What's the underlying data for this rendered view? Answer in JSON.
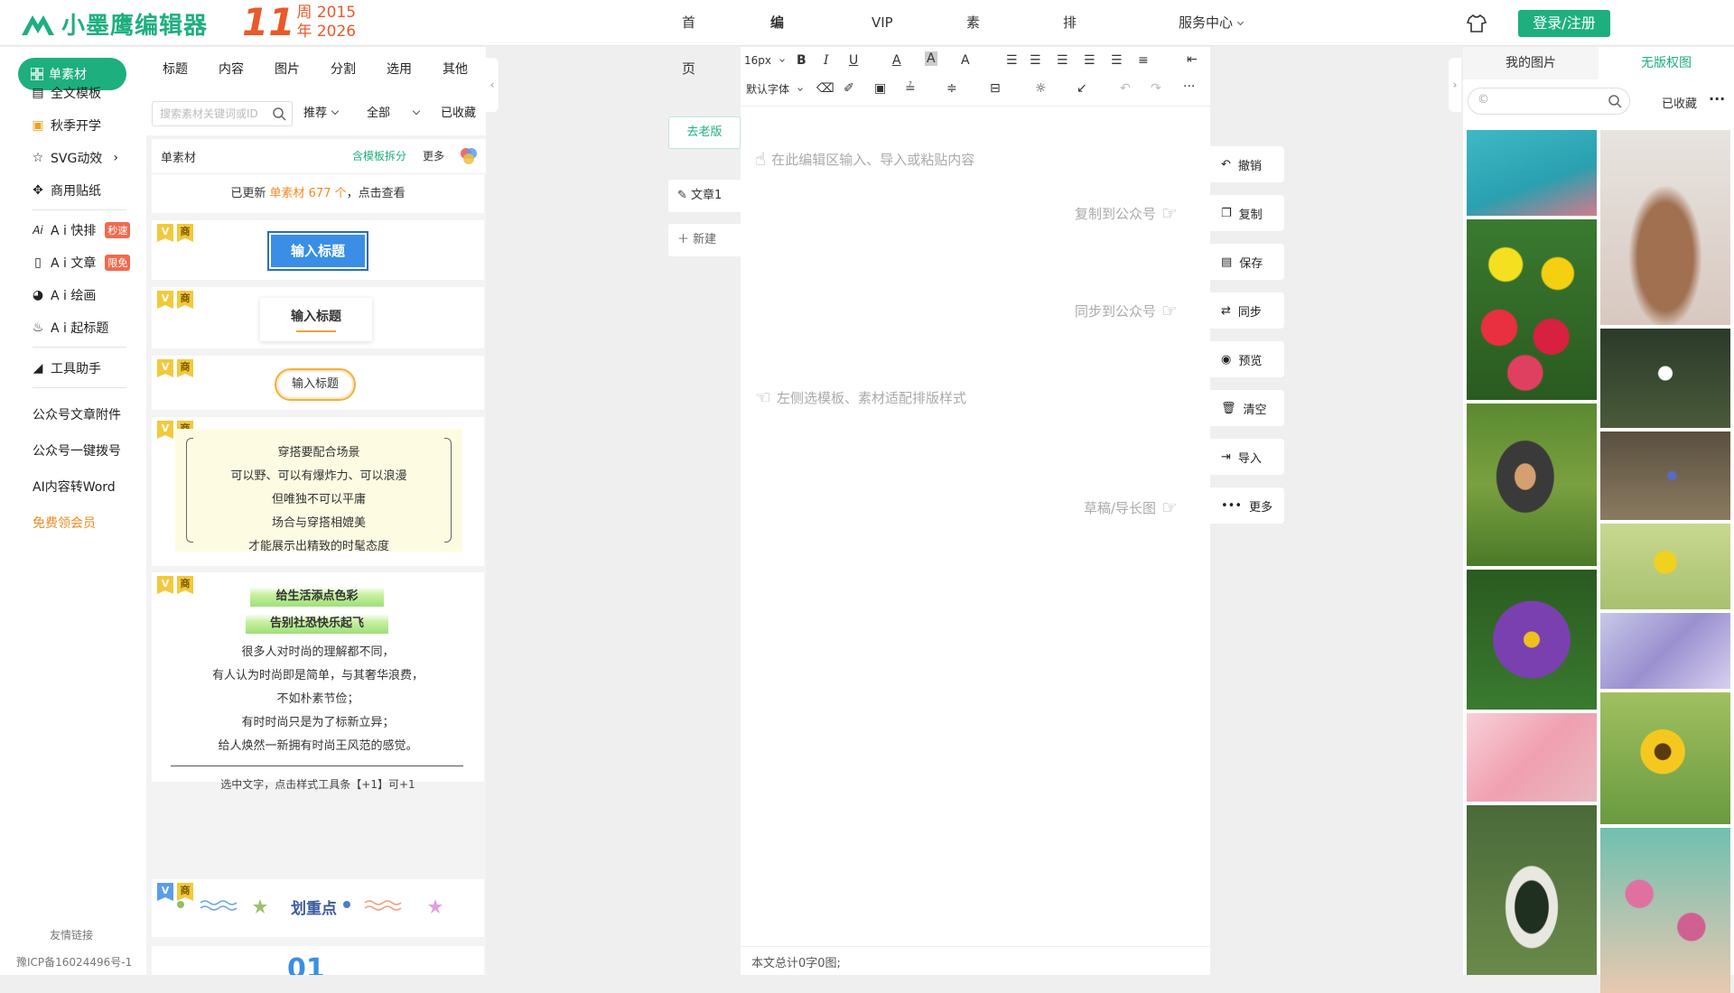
{
  "brand": {
    "name": "小墨鹰编辑器",
    "anniv_num": "11",
    "anniv_line1": "周 2015",
    "anniv_line2": "年 2026",
    "color": "#1eaf7e"
  },
  "nav": [
    {
      "label": "首页"
    },
    {
      "label": "编辑器"
    },
    {
      "label": "VIP会员"
    },
    {
      "label": "素材库"
    },
    {
      "label": "排版课堂"
    },
    {
      "label": "服务中心"
    }
  ],
  "login_label": "登录/注册",
  "sidebar": {
    "active": "单素材",
    "items": [
      {
        "label": "全文模板"
      },
      {
        "label": "秋季开学"
      },
      {
        "label": "SVG动效"
      },
      {
        "label": "商用贴纸"
      },
      {
        "label": "A i 快排",
        "badge": "秒速"
      },
      {
        "label": "A i 文章",
        "badge": "限免"
      },
      {
        "label": "A i 绘画"
      },
      {
        "label": "A i 起标题"
      },
      {
        "label": "工具助手"
      }
    ],
    "links": [
      "公众号文章附件",
      "公众号一键拨号",
      "AI内容转Word",
      "免费领会员"
    ],
    "friend_links": "友情链接",
    "icp": "豫ICP备16024496号-1"
  },
  "materials": {
    "tabs": [
      "标题",
      "内容",
      "图片",
      "分割",
      "选用",
      "其他"
    ],
    "search_placeholder": "搜索素材关键词或ID",
    "filter1": "推荐",
    "filter2": "全部",
    "collected": "已收藏",
    "subhead_title": "单素材",
    "subhead_split": "含模板拆分",
    "subhead_more": "更多",
    "update_prefix": "已更新 ",
    "update_highlight": "单素材 677 个",
    "update_suffix": "，点击查看",
    "tag_v": "V",
    "tag_s": "商",
    "card1_title": "输入标题",
    "card2_title": "输入标题",
    "card3_title": "输入标题",
    "card4_lines": [
      "穿搭要配合场景",
      "可以野、可以有爆炸力、可以浪漫",
      "但唯独不可以平庸",
      "场合与穿搭相媲美",
      "才能展示出精致的时髦态度"
    ],
    "card5_heads": [
      "给生活添点色彩",
      "告别社恐快乐起飞"
    ],
    "card5_lines": [
      "很多人对时尚的理解都不同，",
      "有人认为时尚即是简单，与其奢华浪费，",
      "不如朴素节俭；",
      "有时时尚只是为了标新立异；",
      "给人焕然一新拥有时尚王风范的感觉。"
    ],
    "card5_hint": "选中文字，点击样式工具条【+1】可+1",
    "card6_title": "划重点",
    "card7_num": "01"
  },
  "editor": {
    "old_version": "去老版",
    "doc_name": "文章1",
    "new_doc": "新建",
    "font_size": "16px",
    "font_family": "默认字体",
    "placeholder": "在此编辑区输入、导入或粘贴内容",
    "hint_copy": "复制到公众号",
    "hint_sync": "同步到公众号",
    "hint_left": "左侧选模板、素材适配排版样式",
    "hint_draft": "草稿/导长图",
    "word_count": "本文总计0字0图;"
  },
  "actions": [
    "撤销",
    "复制",
    "保存",
    "同步",
    "预览",
    "清空",
    "导入",
    "更多"
  ],
  "right_panel": {
    "tab_mine": "我的图片",
    "tab_free": "无版权图",
    "collected": "已收藏"
  }
}
